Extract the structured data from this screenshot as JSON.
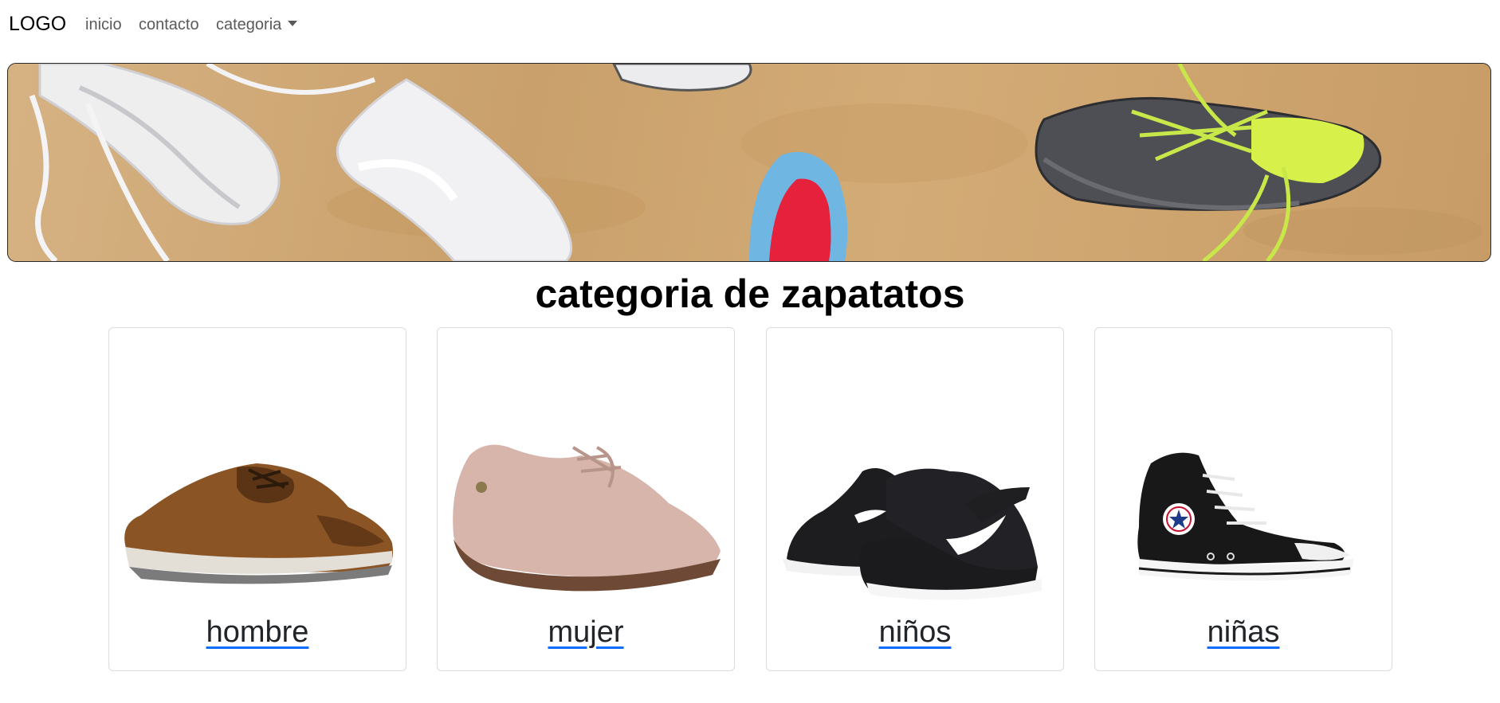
{
  "navbar": {
    "brand": "LOGO",
    "links": [
      "inicio",
      "contacto",
      "categoria"
    ]
  },
  "hero": {
    "image_name": "shoes-on-sand-banner-image"
  },
  "page": {
    "title": "categoria de zapatatos"
  },
  "categories": [
    {
      "label": "hombre",
      "image_name": "brown-leather-shoe"
    },
    {
      "label": "mujer",
      "image_name": "pink-suede-shoe"
    },
    {
      "label": "niños",
      "image_name": "black-nike-kids-shoes"
    },
    {
      "label": "niñas",
      "image_name": "black-converse-high-top"
    }
  ],
  "colors": {
    "link_underline": "#0d6efd",
    "card_border": "#dcdcdc"
  }
}
